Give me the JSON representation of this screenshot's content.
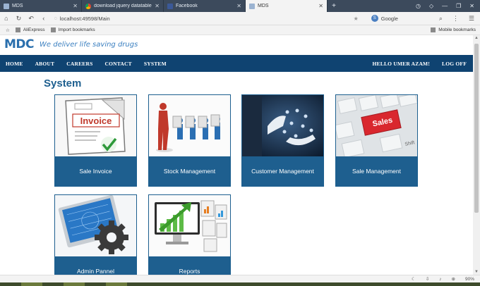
{
  "browser": {
    "tabs": [
      {
        "title": "MDS",
        "icon": "page-icon"
      },
      {
        "title": "download jquery datatables.n",
        "icon": "chrome-icon"
      },
      {
        "title": "Facebook",
        "icon": "facebook-icon"
      },
      {
        "title": "MDS",
        "icon": "page-icon"
      }
    ],
    "url": "localhost:49598/Main",
    "search_engine": "Google",
    "bookmarks": [
      "AliExpress",
      "Import bookmarks"
    ],
    "mobile_bookmarks": "Mobile bookmarks",
    "zoom": "90%"
  },
  "site": {
    "logo": "MDC",
    "tagline": "We deliver life saving drugs",
    "nav_left": [
      "HOME",
      "ABOUT",
      "CAREERS",
      "CONTACT",
      "SYSTEM"
    ],
    "greeting": "HELLO UMER AZAM!",
    "logout": "LOG OFF",
    "page_title": "System"
  },
  "tiles": [
    {
      "label": "Sale Invoice",
      "icon": "invoice-icon"
    },
    {
      "label": "Stock Management",
      "icon": "stock-people-icon"
    },
    {
      "label": "Customer Management",
      "icon": "customer-network-icon"
    },
    {
      "label": "Sale Management",
      "icon": "sales-key-icon"
    },
    {
      "label": "Admin Pannel",
      "icon": "admin-gear-icon"
    },
    {
      "label": "Reports",
      "icon": "reports-chart-icon"
    }
  ],
  "colors": {
    "nav_bg": "#0f4371",
    "tile_caption_bg": "#1e5f8f",
    "title_color": "#1e5f8f",
    "tab_strip_bg": "#3c4a5c"
  }
}
